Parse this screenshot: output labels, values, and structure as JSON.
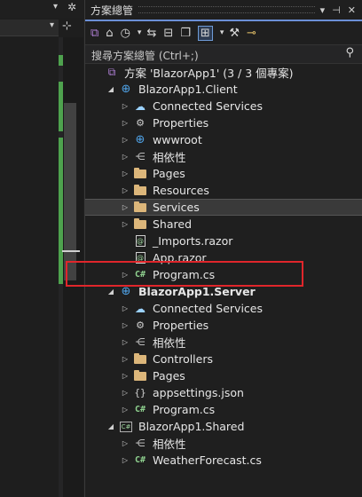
{
  "explorer": {
    "title": "方案總管",
    "search_placeholder": "搜尋方案總管 (Ctrl+;)"
  },
  "tree": [
    {
      "label": "方案 'BlazorApp1' (3 / 3 個專案)",
      "icon": "solution-icon",
      "indent": 0,
      "expander": "",
      "bold": false
    },
    {
      "label": "BlazorApp1.Client",
      "icon": "web-project-icon",
      "indent": 1,
      "expander": "expanded",
      "bold": false
    },
    {
      "label": "Connected Services",
      "icon": "connected-services-icon",
      "indent": 2,
      "expander": "collapsed",
      "bold": false
    },
    {
      "label": "Properties",
      "icon": "properties-icon",
      "indent": 2,
      "expander": "collapsed",
      "bold": false
    },
    {
      "label": "wwwroot",
      "icon": "globe-icon",
      "indent": 2,
      "expander": "collapsed",
      "bold": false
    },
    {
      "label": "相依性",
      "icon": "dependencies-icon",
      "indent": 2,
      "expander": "collapsed",
      "bold": false
    },
    {
      "label": "Pages",
      "icon": "folder-icon",
      "indent": 2,
      "expander": "collapsed",
      "bold": false
    },
    {
      "label": "Resources",
      "icon": "folder-icon",
      "indent": 2,
      "expander": "collapsed",
      "bold": false
    },
    {
      "label": "Services",
      "icon": "folder-icon",
      "indent": 2,
      "expander": "collapsed",
      "bold": false,
      "selected": true
    },
    {
      "label": "Shared",
      "icon": "folder-icon",
      "indent": 2,
      "expander": "collapsed",
      "bold": false
    },
    {
      "label": "_Imports.razor",
      "icon": "razor-file-icon",
      "indent": 2,
      "expander": "",
      "bold": false
    },
    {
      "label": "App.razor",
      "icon": "razor-file-icon",
      "indent": 2,
      "expander": "",
      "bold": false
    },
    {
      "label": "Program.cs",
      "icon": "csharp-file-icon",
      "indent": 2,
      "expander": "collapsed",
      "bold": false
    },
    {
      "label": "BlazorApp1.Server",
      "icon": "web-project-icon",
      "indent": 1,
      "expander": "expanded",
      "bold": true
    },
    {
      "label": "Connected Services",
      "icon": "connected-services-icon",
      "indent": 2,
      "expander": "collapsed",
      "bold": false
    },
    {
      "label": "Properties",
      "icon": "properties-icon",
      "indent": 2,
      "expander": "collapsed",
      "bold": false
    },
    {
      "label": "相依性",
      "icon": "dependencies-icon",
      "indent": 2,
      "expander": "collapsed",
      "bold": false
    },
    {
      "label": "Controllers",
      "icon": "folder-icon",
      "indent": 2,
      "expander": "collapsed",
      "bold": false
    },
    {
      "label": "Pages",
      "icon": "folder-icon",
      "indent": 2,
      "expander": "collapsed",
      "bold": false
    },
    {
      "label": "appsettings.json",
      "icon": "json-file-icon",
      "indent": 2,
      "expander": "collapsed",
      "bold": false
    },
    {
      "label": "Program.cs",
      "icon": "csharp-file-icon",
      "indent": 2,
      "expander": "collapsed",
      "bold": false
    },
    {
      "label": "BlazorApp1.Shared",
      "icon": "csharp-project-icon",
      "indent": 1,
      "expander": "expanded",
      "bold": false
    },
    {
      "label": "相依性",
      "icon": "dependencies-icon",
      "indent": 2,
      "expander": "collapsed",
      "bold": false
    },
    {
      "label": "WeatherForecast.cs",
      "icon": "csharp-file-icon",
      "indent": 2,
      "expander": "collapsed",
      "bold": false
    }
  ],
  "colors": {
    "accent": "#6b8fd6",
    "highlight_box": "#e0262b",
    "folder": "#dcb67a",
    "gutter_change": "#4ea24e"
  }
}
